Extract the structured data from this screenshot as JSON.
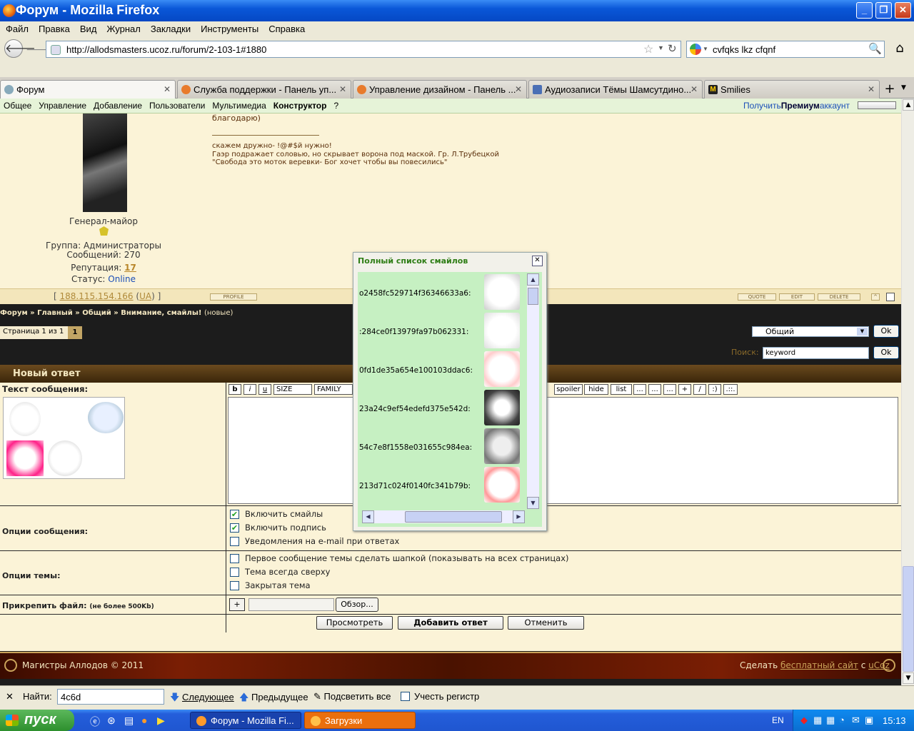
{
  "window": {
    "title": "Форум - Mozilla Firefox"
  },
  "menu": [
    "Файл",
    "Правка",
    "Вид",
    "Журнал",
    "Закладки",
    "Инструменты",
    "Справка"
  ],
  "url": "http://allodsmasters.ucoz.ru/forum/2-103-1#1880",
  "search_query": "cvfqks lkz cfqnf",
  "tabs": [
    {
      "label": "Форум"
    },
    {
      "label": "Служба поддержки - Панель уп..."
    },
    {
      "label": "Управление дизайном - Панель ..."
    },
    {
      "label": "Аудиозаписи Тёмы Шамсутдино..."
    },
    {
      "label": "Smilies"
    }
  ],
  "ucoz_menu": [
    "Общее",
    "Управление",
    "Добавление",
    "Пользователи",
    "Мультимедиа",
    "Конструктор",
    "?"
  ],
  "ucoz_premium": {
    "pre": "Получить ",
    "bold": "Премиум",
    "post": " аккаунт"
  },
  "post": {
    "text_top": "благодарю)",
    "sig1": "скажем дружно- !@#$й нужно!",
    "sig2": "Гаэр подражает соловью, но скрывает ворона под маской. Гр. Л.Трубецкой",
    "sig3": "\"Свобода это моток веревки- Бог хочет чтобы вы повесились\"",
    "rank": "Генерал-майор",
    "group": "Группа: Администраторы",
    "messages": "Сообщений: 270",
    "rep_label": "Репутация: ",
    "rep_value": "17",
    "status_label": "Статус: ",
    "status_value": "Online",
    "ip_open": "[ ",
    "ip": "188.115.154.166",
    "ip_country": "UA",
    "ip_close": " ]",
    "btn_profile": "PROFILE",
    "btn_quote": "QUOTE",
    "btn_edit": "EDIT",
    "btn_delete": "DELETE"
  },
  "breadcrumb": {
    "items": [
      "Форум",
      "Главный",
      "Общий",
      "Внимание, смайлы!"
    ],
    "suffix": "(новые)"
  },
  "pager": {
    "label": "Страница 1 из 1",
    "current": "1"
  },
  "forum_select": "Общий",
  "ok_label": "Ok",
  "search_label": "Поиск:",
  "search_value": "keyword",
  "reply": {
    "header": "Новый ответ",
    "text_label": "Текст сообщения:",
    "toolbar": [
      "b",
      "i",
      "u",
      "SIZE",
      "FAMILY",
      "spoiler",
      "hide",
      "list",
      "...",
      "...",
      "...",
      "+",
      "/",
      ":)",
      ".::."
    ],
    "options_label": "Опции сообщения:",
    "opt_smiles": "Включить смайлы",
    "opt_sig": "Включить подпись",
    "opt_email": "Уведомления на e-mail при ответах",
    "topic_label": "Опции темы:",
    "topic_pin": "Первое сообщение темы сделать шапкой (показывать на всех страницах)",
    "topic_top": "Тема всегда сверху",
    "topic_closed": "Закрытая тема",
    "attach_label": "Прикрепить файл:",
    "attach_note": "(не более 500Kb)",
    "attach_plus": "+",
    "browse": "Обзор...",
    "preview": "Просмотреть",
    "submit": "Добавить ответ",
    "cancel": "Отменить"
  },
  "footer": {
    "copyright": "Магистры Аллодов © 2011",
    "make": "Сделать ",
    "free": "бесплатный сайт",
    "with": " с ",
    "ucoz": "uCoz"
  },
  "popup": {
    "title": "Полный список смайлов",
    "smilies": [
      "o2458fc529714f36346633a6:",
      ":284ce0f13979fa97b062331:",
      "0fd1de35a654e100103ddac6:",
      "23a24c9ef54edefd375e542d:",
      "54c7e8f1558e031655c984ea:",
      "213d71c024f0140fc341b79b:"
    ]
  },
  "findbar": {
    "label": "Найти:",
    "value": "4c6d",
    "next": "Следующее",
    "prev": "Предыдущее",
    "highlight": "Подсветить все",
    "matchcase": "Учесть регистр"
  },
  "taskbar": {
    "start": "пуск",
    "tasks": [
      "Форум - Mozilla Fi...",
      "Загрузки"
    ],
    "lang": "EN",
    "clock": "15:13"
  }
}
